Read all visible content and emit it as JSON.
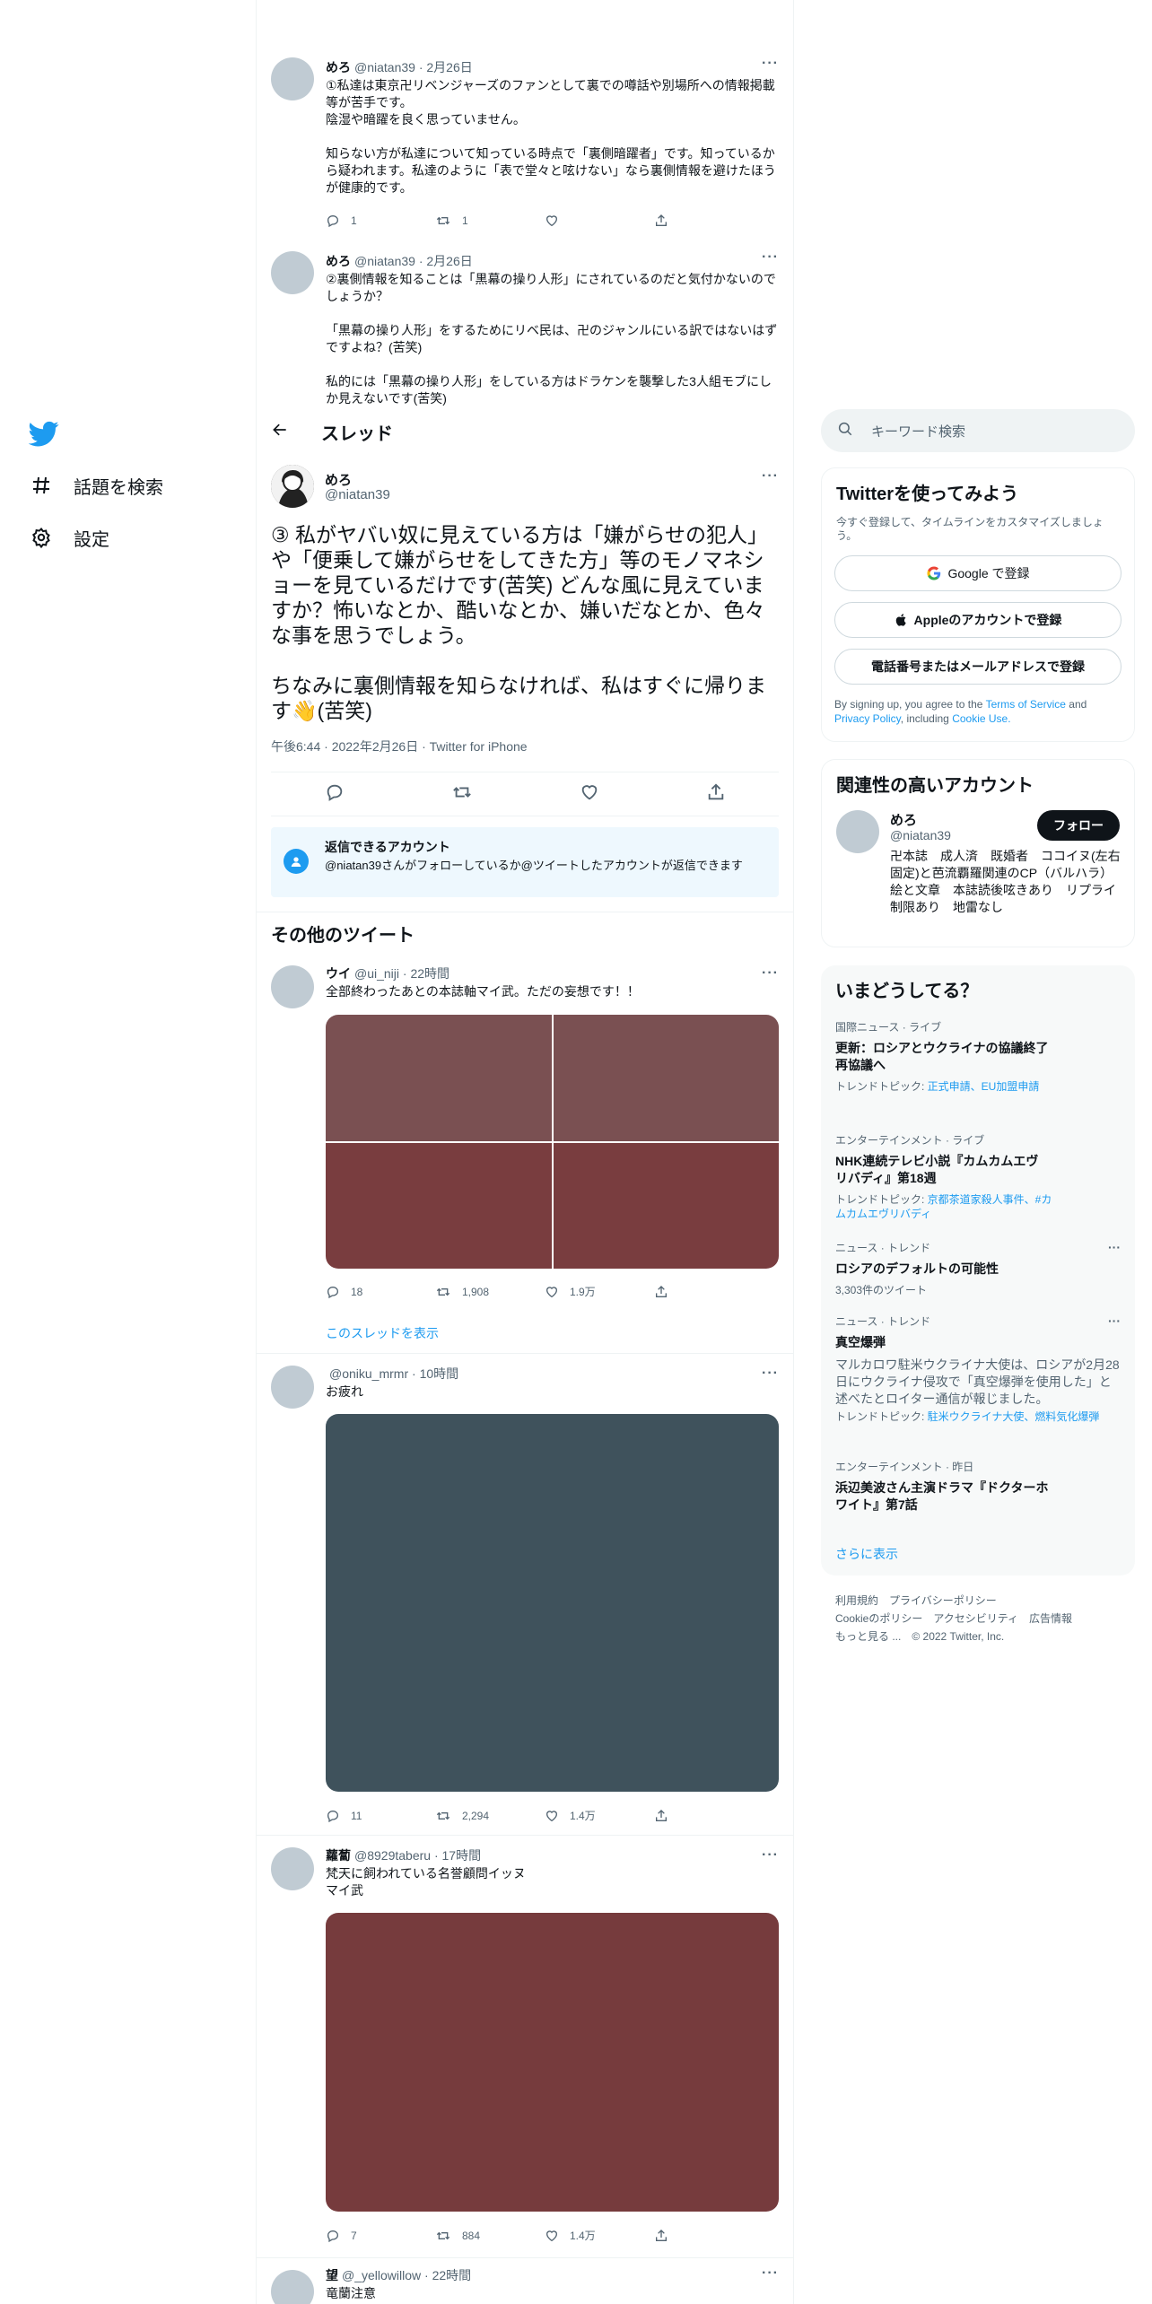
{
  "nav": {
    "explore_label": "話題を検索",
    "settings_label": "設定"
  },
  "thread_header": {
    "title": "スレッド"
  },
  "prev_tweets": [
    {
      "name": "めろ",
      "handle": "@niatan39",
      "time": "· 2月26日",
      "text": "①私達は東京卍リベンジャーズのファンとして裏での噂話や別場所への情報掲載等が苦手です。\n陰湿や暗躍を良く思っていません。\n\n知らない方が私達について知っている時点で「裏側暗躍者」です。知っているから疑われます。私達のように「表で堂々と呟けない」なら裏側情報を避けたほうが健康的です。",
      "reply_count": "1",
      "retweet_count": "1"
    },
    {
      "name": "めろ",
      "handle": "@niatan39",
      "time": "· 2月26日",
      "text": "②裏側情報を知ることは「黒幕の操り人形」にされているのだと気付かないのでしょうか？\n\n「黒幕の操り人形」をするためにリベ民は、卍のジャンルにいる訳ではないはずですよね？(苦笑)\n\n私的には「黒幕の操り人形」をしている方はドラケンを襲撃した3人組モブにしか見えないです(苦笑)"
    }
  ],
  "focal": {
    "name": "めろ",
    "handle": "@niatan39",
    "text": "③ 私がヤバい奴に見えている方は「嫌がらせの犯人」や「便乗して嫌がらせをしてきた方」等のモノマネショーを見ているだけです(苦笑) どんな風に見えていますか？怖いなとか、酷いなとか、嫌いだなとか、色々な事を思うでしょう。\n\nちなみに裏側情報を知らなければ、私はすぐに帰ります👋(苦笑)",
    "meta": "午後6:44 · 2022年2月26日 · Twitter for iPhone"
  },
  "reply_notice": {
    "title": "返信できるアカウント",
    "text": "@niatan39さんがフォローしているか@ツイートしたアカウントが返信できます"
  },
  "more_tweets_title": "その他のツイート",
  "more_tweets": [
    {
      "name": "ウイ",
      "handle": "@ui_niji",
      "time": "· 22時間",
      "text": "全部終わったあとの本誌軸マイ武。ただの妄想です！！",
      "reply_count": "18",
      "retweet_count": "1,908",
      "like_count": "1.9万",
      "show_thread": "このスレッドを表示",
      "media_colors": [
        "#7a5052",
        "#7a5052",
        "#793d3f",
        "#793d3f"
      ]
    },
    {
      "name": "",
      "handle": "@oniku_mrmr",
      "time": "· 10時間",
      "text": "お疲れ",
      "reply_count": "11",
      "retweet_count": "2,294",
      "like_count": "1.4万",
      "media_colors": [
        "#3f525c"
      ]
    },
    {
      "name": "蘿蔔",
      "handle": "@8929taberu",
      "time": "· 17時間",
      "text": "梵天に飼われている名誉顧問イッヌ\nマイ武",
      "reply_count": "7",
      "retweet_count": "884",
      "like_count": "1.4万",
      "media_colors": [
        "#763b3d"
      ]
    },
    {
      "name": "望",
      "handle": "@_yellowillow",
      "time": "· 22時間",
      "text": "竜蘭注意"
    }
  ],
  "sidebar": {
    "search_placeholder": "キーワード検索",
    "signup": {
      "title": "Twitterを使ってみよう",
      "subtitle": "今すぐ登録して、タイムラインをカスタマイズしましょう。",
      "google_label": "Google で登録",
      "apple_label": "Appleのアカウントで登録",
      "phone_label": "電話番号またはメールアドレスで登録",
      "terms_prefix": "By signing up, you agree to the",
      "terms_link": "Terms of Service",
      "terms_and": "and",
      "privacy_link": "Privacy Policy",
      "terms_including": ", including",
      "cookie_link": "Cookie Use."
    },
    "related": {
      "title": "関連性の高いアカウント",
      "name": "めろ",
      "handle": "@niatan39",
      "follow_label": "フォロー",
      "bio": "卍本誌　成人済　既婚者　ココイヌ(左右固定)と芭流覇羅関連のCP（バルハラ）　絵と文章　本誌読後呟きあり　リプライ制限あり　地雷なし"
    },
    "trends": {
      "title": "いまどうしてる？",
      "items": [
        {
          "category": "国際ニュース · ライブ",
          "title": "更新：ロシアとウクライナの協議終了 再協議へ",
          "topic_prefix": "トレンドトピック: ",
          "topic_links": "正式申請、EU加盟申請"
        },
        {
          "category": "エンターテインメント · ライブ",
          "title": "NHK連続テレビ小説『カムカムエヴリバディ』第18週",
          "topic_prefix": "トレンドトピック: ",
          "topic_links": "京都茶道家殺人事件、#カムカムエヴリバディ"
        },
        {
          "category": "ニュース · トレンド",
          "title": "ロシアのデフォルトの可能性",
          "count": "3,303件のツイート"
        },
        {
          "category": "ニュース · トレンド",
          "title": "真空爆弾",
          "description": "マルカロワ駐米ウクライナ大使は、ロシアが2月28日にウクライナ侵攻で「真空爆弾を使用した」と述べたとロイター通信が報じました。",
          "topic_prefix": "トレンドトピック: ",
          "topic_links": "駐米ウクライナ大使、燃料気化爆弾"
        },
        {
          "category": "エンターテインメント · 昨日",
          "title": "浜辺美波さん主演ドラマ『ドクターホワイト』第7話"
        }
      ],
      "show_more": "さらに表示"
    },
    "footer": {
      "terms": "利用規約",
      "privacy": "プライバシーポリシー",
      "cookie": "Cookieのポリシー",
      "accessibility": "アクセシビリティ",
      "ads": "広告情報",
      "more": "もっと見る ...",
      "copyright": "© 2022 Twitter, Inc."
    }
  },
  "colors": {
    "accent": "#1d9bf0",
    "text": "#0f1419",
    "secondary": "#536471"
  }
}
